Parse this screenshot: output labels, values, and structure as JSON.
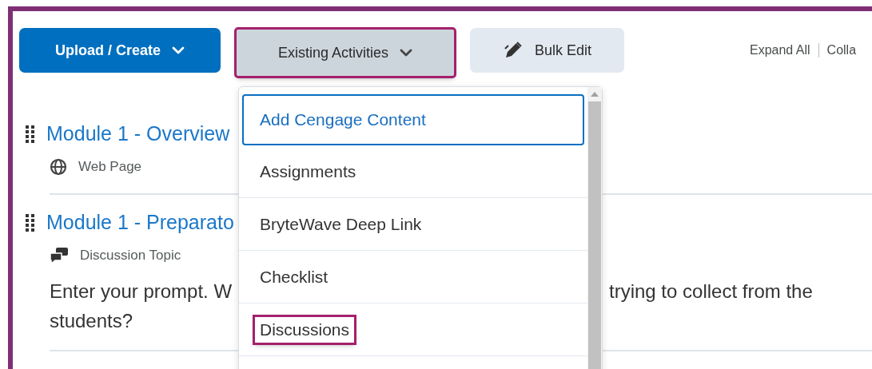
{
  "toolbar": {
    "buttons": [
      {
        "kind": "primary",
        "label": "Upload / Create",
        "caret": true,
        "highlighted": false
      },
      {
        "kind": "secondary",
        "label": "Existing Activities",
        "caret": true,
        "highlighted": true
      },
      {
        "kind": "bulk",
        "label": "Bulk Edit",
        "caret": false,
        "highlighted": false
      }
    ],
    "links": [
      "Expand All",
      "Colla"
    ]
  },
  "modules": [
    {
      "kind": "webpage",
      "title": "Module 1 - Overview",
      "type_label": "Web Page"
    },
    {
      "kind": "discussion",
      "title": "Module 1 - Preparato",
      "type_label": "Discussion Topic",
      "prompt_lines": [
        [
          "Enter your prompt. W",
          "trying to collect from the"
        ],
        [
          "students?"
        ]
      ]
    }
  ],
  "menu": {
    "items": [
      {
        "label": "Add Cengage Content",
        "focused": true,
        "highlighted": false
      },
      {
        "label": "Assignments",
        "focused": false,
        "highlighted": false
      },
      {
        "label": "BryteWave Deep Link",
        "focused": false,
        "highlighted": false
      },
      {
        "label": "Checklist",
        "focused": false,
        "highlighted": false
      },
      {
        "label": "Discussions",
        "focused": false,
        "highlighted": true
      }
    ]
  }
}
